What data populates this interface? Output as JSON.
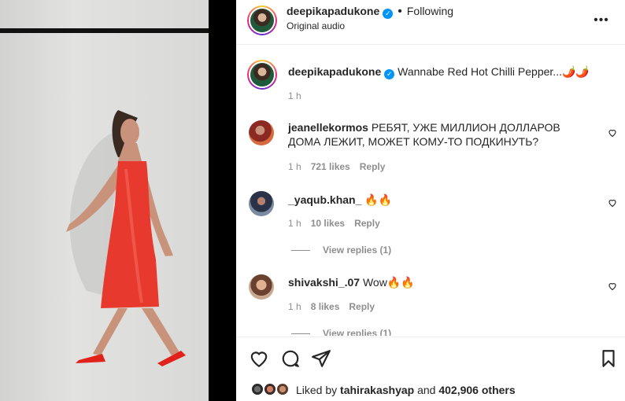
{
  "post": {
    "author": "deepikapadukone",
    "audio": "Original audio",
    "follow_dot": "•",
    "follow_status": "Following",
    "more": "•••",
    "caption": "Wannabe Red Hot Chilli Pepper...🌶️🌶️",
    "caption_time": "1 h"
  },
  "comments": [
    {
      "username": "jeanellekormos",
      "text": "РЕБЯТ, УЖЕ МИЛЛИОН ДОЛЛАРОВ ДОМА ЛЕЖИТ, МОЖЕТ КОМУ-ТО ПОДКИНУТЬ?",
      "time": "1 h",
      "likes": "721 likes",
      "reply": "Reply"
    },
    {
      "username": "_yaqub.khan_",
      "text": "🔥🔥",
      "time": "1 h",
      "likes": "10 likes",
      "reply": "Reply",
      "view_replies": "View replies (1)"
    },
    {
      "username": "shivakshi_.07",
      "text": "Wow🔥🔥",
      "time": "1 h",
      "likes": "8 likes",
      "reply": "Reply",
      "view_replies": "View replies (1)"
    }
  ],
  "likes_bar": {
    "prefix": "Liked by ",
    "user": "tahirakashyap",
    "middle": " and ",
    "count": "402,906 others"
  },
  "icons": {
    "header_more": "more-options-icon",
    "verified": "verified-badge-icon",
    "heart": "heart-icon",
    "comment": "comment-icon",
    "share": "share-icon",
    "save": "bookmark-icon"
  }
}
